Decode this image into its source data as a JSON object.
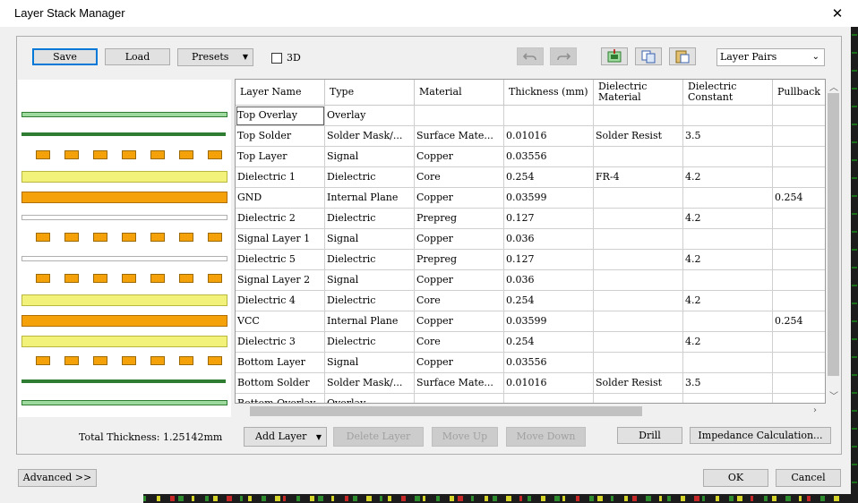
{
  "window": {
    "title": "Layer Stack Manager",
    "close_glyph": "✕"
  },
  "toolbar": {
    "save_label": "Save",
    "load_label": "Load",
    "presets_label": "Presets",
    "three_d_label": "3D",
    "three_d_checked": false,
    "icons": [
      "undo-icon",
      "redo-icon",
      "add-layer-pair-icon",
      "copy-icon",
      "paste-icon"
    ],
    "view_select_value": "Layer Pairs"
  },
  "table": {
    "columns": [
      "Layer Name",
      "Type",
      "Material",
      "Thickness (mm)",
      "Dielectric\nMaterial",
      "Dielectric\nConstant",
      "Pullback"
    ],
    "rows": [
      [
        "Top Overlay",
        "Overlay",
        "",
        "",
        "",
        "",
        ""
      ],
      [
        "Top Solder",
        "Solder Mask/...",
        "Surface Mate...",
        "0.01016",
        "Solder Resist",
        "3.5",
        ""
      ],
      [
        "Top Layer",
        "Signal",
        "Copper",
        "0.03556",
        "",
        "",
        ""
      ],
      [
        "Dielectric 1",
        "Dielectric",
        "Core",
        "0.254",
        "FR-4",
        "4.2",
        ""
      ],
      [
        "GND",
        "Internal Plane",
        "Copper",
        "0.03599",
        "",
        "",
        "0.254"
      ],
      [
        "Dielectric 2",
        "Dielectric",
        "Prepreg",
        "0.127",
        "",
        "4.2",
        ""
      ],
      [
        "Signal Layer 1",
        "Signal",
        "Copper",
        "0.036",
        "",
        "",
        ""
      ],
      [
        "Dielectric 5",
        "Dielectric",
        "Prepreg",
        "0.127",
        "",
        "4.2",
        ""
      ],
      [
        "Signal Layer 2",
        "Signal",
        "Copper",
        "0.036",
        "",
        "",
        ""
      ],
      [
        "Dielectric 4",
        "Dielectric",
        "Core",
        "0.254",
        "",
        "4.2",
        ""
      ],
      [
        "VCC",
        "Internal Plane",
        "Copper",
        "0.03599",
        "",
        "",
        "0.254"
      ],
      [
        "Dielectric 3",
        "Dielectric",
        "Core",
        "0.254",
        "",
        "4.2",
        ""
      ],
      [
        "Bottom Layer",
        "Signal",
        "Copper",
        "0.03556",
        "",
        "",
        ""
      ],
      [
        "Bottom Solder",
        "Solder Mask/...",
        "Surface Mate...",
        "0.01016",
        "Solder Resist",
        "3.5",
        ""
      ],
      [
        "Bottom Overlay",
        "Overlay",
        "",
        "",
        "",
        "",
        ""
      ]
    ]
  },
  "stack_preview": [
    {
      "kind": "overlay"
    },
    {
      "kind": "solder"
    },
    {
      "kind": "signal"
    },
    {
      "kind": "core"
    },
    {
      "kind": "plane"
    },
    {
      "kind": "prepreg"
    },
    {
      "kind": "signal"
    },
    {
      "kind": "prepreg"
    },
    {
      "kind": "signal"
    },
    {
      "kind": "core"
    },
    {
      "kind": "plane"
    },
    {
      "kind": "core"
    },
    {
      "kind": "signal"
    },
    {
      "kind": "solder"
    },
    {
      "kind": "overlay"
    }
  ],
  "colors": {
    "overlay": "#9ed99e",
    "solder_outline": "#2e7d32",
    "copper": "#f5a20a",
    "core": "#f2f27a",
    "prepreg": "#b0b0b0",
    "accent": "#0078d7"
  },
  "bottom": {
    "total_thickness": "Total Thickness: 1.25142mm",
    "add_layer_label": "Add Layer",
    "delete_layer_label": "Delete Layer",
    "move_up_label": "Move Up",
    "move_down_label": "Move Down",
    "drill_label": "Drill",
    "impedance_label": "Impedance Calculation..."
  },
  "footer": {
    "advanced_label": "Advanced >>",
    "ok_label": "OK",
    "cancel_label": "Cancel"
  }
}
